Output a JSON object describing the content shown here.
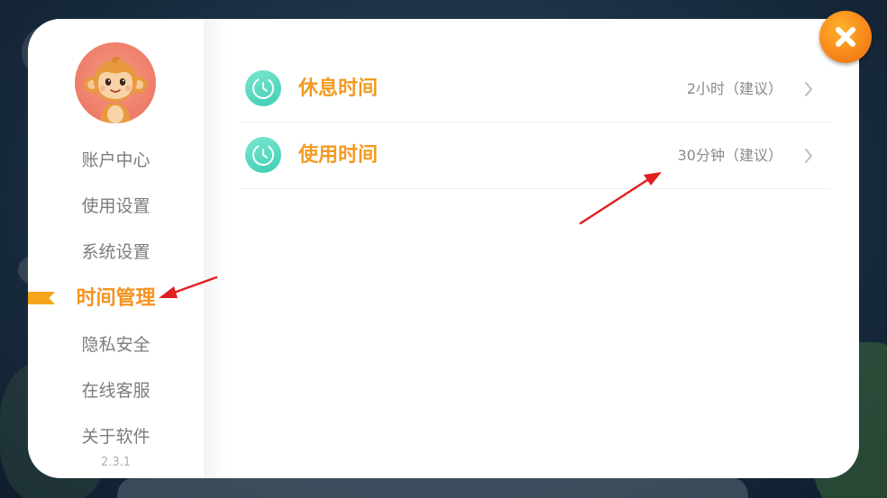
{
  "sidebar": {
    "items": [
      {
        "label": "账户中心"
      },
      {
        "label": "使用设置"
      },
      {
        "label": "系统设置"
      },
      {
        "label": "时间管理",
        "active": true
      },
      {
        "label": "隐私安全"
      },
      {
        "label": "在线客服"
      },
      {
        "label": "关于软件"
      }
    ],
    "version": "2.3.1"
  },
  "main": {
    "rows": [
      {
        "title": "休息时间",
        "value": "2小时（建议）",
        "icon": "clock-icon"
      },
      {
        "title": "使用时间",
        "value": "30分钟（建议）",
        "icon": "clock-icon"
      }
    ]
  },
  "icons": {
    "close": "close-icon",
    "chevron": "chevron-right-icon",
    "avatar": "monkey-avatar"
  },
  "colors": {
    "accent": "#f5931f",
    "icon_teal": "#4fd6bd",
    "close_button": "#f7861a",
    "annotation_arrow": "#e02020"
  }
}
